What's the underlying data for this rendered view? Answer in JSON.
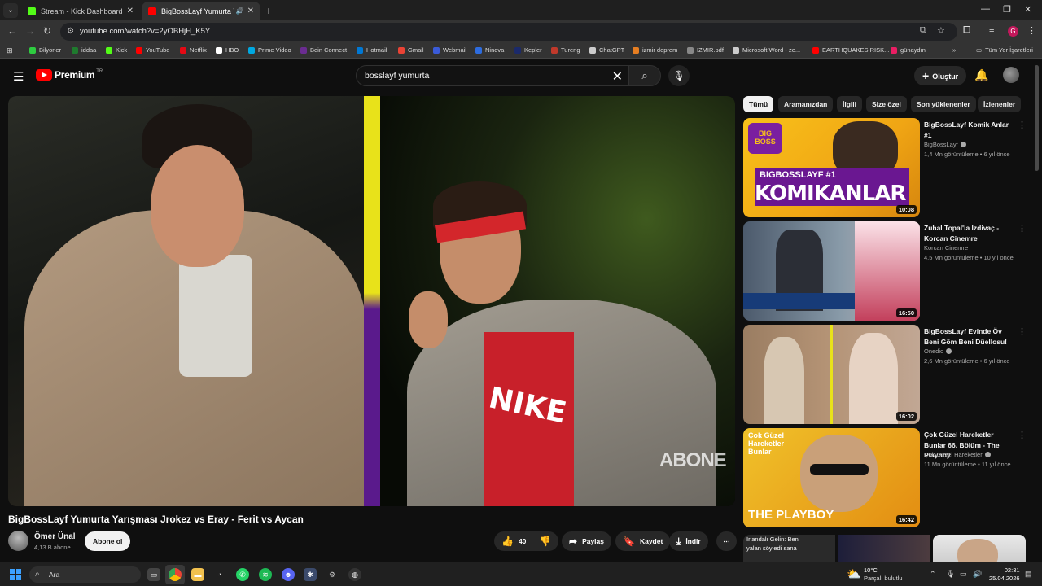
{
  "browser": {
    "tabs": [
      {
        "label": "Stream - Kick Dashboard",
        "favicon_color": "#53fc18"
      },
      {
        "label": "BigBossLayf Yumurta Yarışı",
        "favicon_color": "#ff0000"
      }
    ],
    "url": "youtube.com/watch?v=2yOBHjH_K5Y",
    "profile_initial": "G",
    "bookmarks": [
      {
        "label": "Bilyoner",
        "color": "#2ecc40"
      },
      {
        "label": "iddaa",
        "color": "#1f7a2e"
      },
      {
        "label": "Kick",
        "color": "#53fc18"
      },
      {
        "label": "YouTube",
        "color": "#ff0000"
      },
      {
        "label": "Netflix",
        "color": "#e50914"
      },
      {
        "label": "HBO",
        "color": "#ffffff"
      },
      {
        "label": "Prime Video",
        "color": "#00a8e1"
      },
      {
        "label": "Bein Connect",
        "color": "#6a2c91"
      },
      {
        "label": "Hotmail",
        "color": "#0078d4"
      },
      {
        "label": "Gmail",
        "color": "#ea4335"
      },
      {
        "label": "Webmail",
        "color": "#3a5bd9"
      },
      {
        "label": "Ninova",
        "color": "#2d6cdf"
      },
      {
        "label": "Kepler",
        "color": "#1b2a6b"
      },
      {
        "label": "Tureng",
        "color": "#c0392b"
      },
      {
        "label": "ChatGPT",
        "color": "#cccccc"
      },
      {
        "label": "izmir deprem",
        "color": "#e67e22"
      },
      {
        "label": "IZMIR.pdf",
        "color": "#888888"
      },
      {
        "label": "Microsoft Word - ze...",
        "color": "#cccccc"
      },
      {
        "label": "EARTHQUAKES RISK...",
        "color": "#ff0000"
      },
      {
        "label": "günaydın",
        "color": "#e91e63"
      }
    ],
    "all_bookmarks_label": "Tüm Yer İşaretleri"
  },
  "masthead": {
    "logo_word": "Premium",
    "logo_sup": "TR",
    "search_query": "bosslayf yumurta",
    "create_label": "Oluştur"
  },
  "video": {
    "title": "BigBossLayf Yumurta Yarışması Jrokez vs Eray - Ferit vs Aycan",
    "watermark": "ABONE",
    "shirt_text": "NIKE",
    "channel_name": "Ömer Ünal",
    "channel_subs": "4,13 B abone",
    "subscribe_label": "Abone ol",
    "like_count": "40",
    "share_label": "Paylaş",
    "save_label": "Kaydet",
    "download_label": "İndir"
  },
  "chips": [
    "Tümü",
    "Aramanızdan",
    "İlgili",
    "Size özel",
    "Son yüklenenler",
    "İzlenenler"
  ],
  "recommendations": [
    {
      "title": "BigBossLayf Komik Anlar #1",
      "channel": "BigBossLayf",
      "verified": true,
      "meta": "1,4 Mn görüntüleme • 6 yıl önce",
      "duration": "10:08",
      "thumb_text_top": "BIGBOSSLAYF #1",
      "thumb_text_big": "KOMIKANLAR",
      "thumb_logo": "BIG BOSS"
    },
    {
      "title": "Zuhal Topal'la İzdivaç - Korcan Cinemre",
      "channel": "Korcan Cinemre",
      "verified": false,
      "meta": "4,5 Mn görüntüleme • 10 yıl önce",
      "duration": "16:50"
    },
    {
      "title": "BigBossLayf Evinde Öv Beni Göm Beni Düellosu!",
      "channel": "Onedio",
      "verified": true,
      "meta": "2,6 Mn görüntüleme • 6 yıl önce",
      "duration": "16:02"
    },
    {
      "title": "Çok Güzel Hareketler Bunlar 66. Bölüm - The Playboy",
      "channel": "Çok Güzel Hareketler",
      "verified": true,
      "meta": "11 Mn görüntüleme • 11 yıl önce",
      "duration": "16:42",
      "thumb_text_big": "THE PLAYBOY",
      "thumb_logo": "Çok Güzel Hareketler Bunlar"
    }
  ],
  "partial_rec": {
    "line1": "İrlandalı Gelin: Ben",
    "line2": "yalan söyledi sana"
  },
  "taskbar": {
    "search_label": "Ara",
    "weather_temp": "10°C",
    "weather_desc": "Parçalı bulutlu",
    "time": "02:31",
    "date": "25.04.2026"
  }
}
